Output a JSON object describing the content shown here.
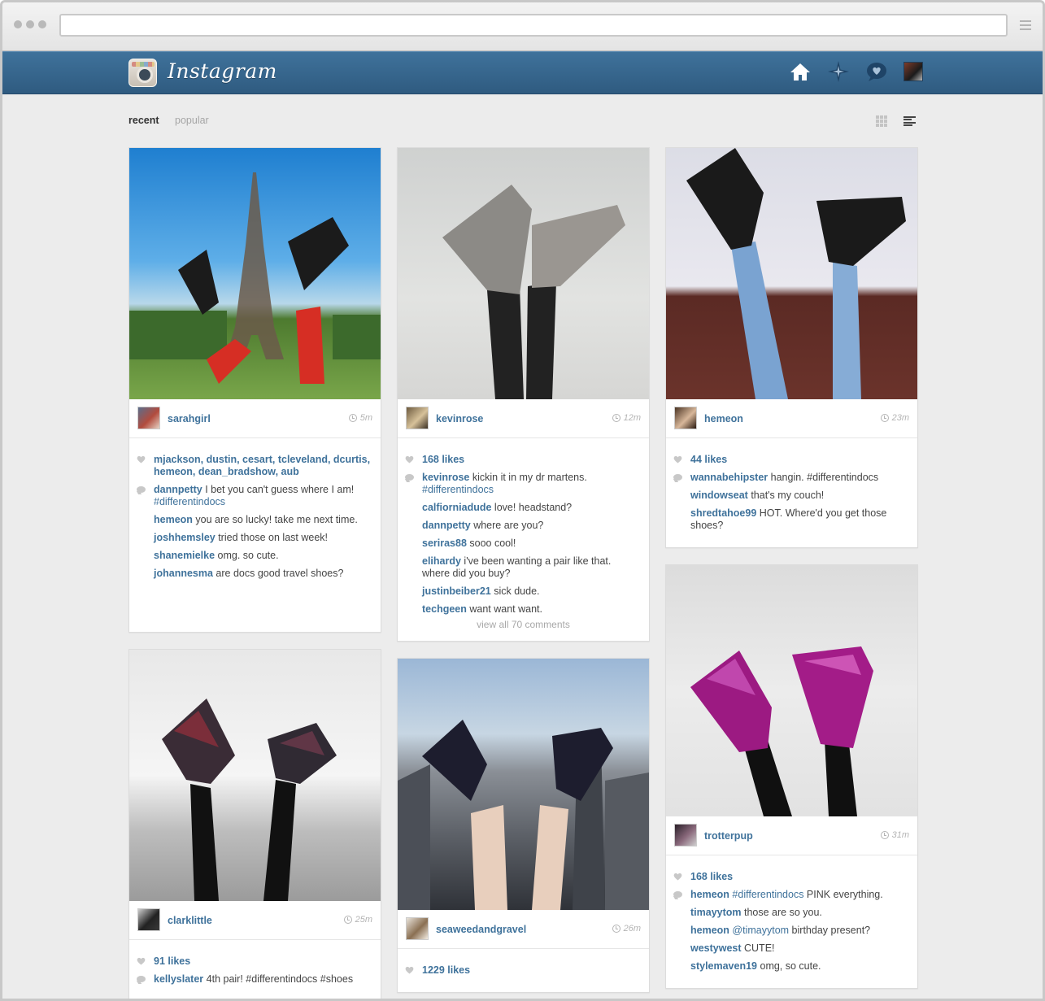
{
  "header": {
    "brand": "Instagram"
  },
  "filters": {
    "recent": "recent",
    "popular": "popular"
  },
  "posts": [
    {
      "user": "sarahgirl",
      "time": "5m",
      "likers": "mjackson, dustin, cesart, tcleveland, dcurtis, hemeon, dean_bradshow, aub",
      "caption": {
        "user": "dannpetty",
        "text": " I bet you can't guess where I am! ",
        "tag": "#differentindocs"
      },
      "comments": [
        {
          "user": "hemeon",
          "text": " you are so lucky! take me next time."
        },
        {
          "user": "joshhemsley",
          "text": " tried those on last week!"
        },
        {
          "user": "shanemielke",
          "text": " omg. so cute."
        },
        {
          "user": "johannesma",
          "text": " are docs good travel shoes?"
        }
      ]
    },
    {
      "user": "kevinrose",
      "time": "12m",
      "likes": "168 likes",
      "caption": {
        "user": "kevinrose",
        "text": " kickin it in my dr martens. ",
        "tag": "#differentindocs"
      },
      "comments": [
        {
          "user": "calfiorniadude",
          "text": " love! headstand?"
        },
        {
          "user": "dannpetty",
          "text": " where are you?"
        },
        {
          "user": "seriras88",
          "text": " sooo cool!"
        },
        {
          "user": "elihardy",
          "text": " i've been wanting a pair like that. where did you buy?"
        },
        {
          "user": "justinbeiber21",
          "text": " sick dude."
        },
        {
          "user": "techgeen",
          "text": " want want want."
        }
      ],
      "view_all": "view all 70 comments"
    },
    {
      "user": "hemeon",
      "time": "23m",
      "likes": "44 likes",
      "caption": {
        "user": "wannabehipster",
        "text": " hangin. #differentindocs"
      },
      "comments": [
        {
          "user": "windowseat",
          "text": " that's my couch!"
        },
        {
          "user": "shredtahoe99",
          "text": " HOT. Where'd you get those shoes?"
        }
      ]
    },
    {
      "user": "clarklittle",
      "time": "25m",
      "likes": "91 likes",
      "caption": {
        "user": "kellyslater",
        "text": " 4th pair! #differentindocs #shoes"
      }
    },
    {
      "user": "seaweedandgravel",
      "time": "26m",
      "likes": "1229 likes"
    },
    {
      "user": "trotterpup",
      "time": "31m",
      "likes": "168 likes",
      "caption": {
        "user": "hemeon",
        "text": " PINK everything.",
        "tag": "#differentindocs"
      },
      "comments": [
        {
          "user": "timayytom",
          "text": " those are so you."
        },
        {
          "user": "hemeon",
          "text": " birthday present?",
          "tag": "@timayytom"
        },
        {
          "user": "westywest",
          "text": " CUTE!"
        },
        {
          "user": "stylemaven19",
          "text": " omg, so cute."
        }
      ]
    }
  ],
  "colors": {
    "brand_blue": "#3f729b",
    "header_top": "#3f729b",
    "header_bottom": "#2f5b80",
    "page_bg": "#ececec"
  },
  "icons": [
    "home-icon",
    "explore-compass-icon",
    "news-bubble-icon",
    "profile-avatar",
    "grid-view-icon",
    "list-view-icon",
    "heart-icon",
    "comment-icon",
    "clock-icon"
  ]
}
